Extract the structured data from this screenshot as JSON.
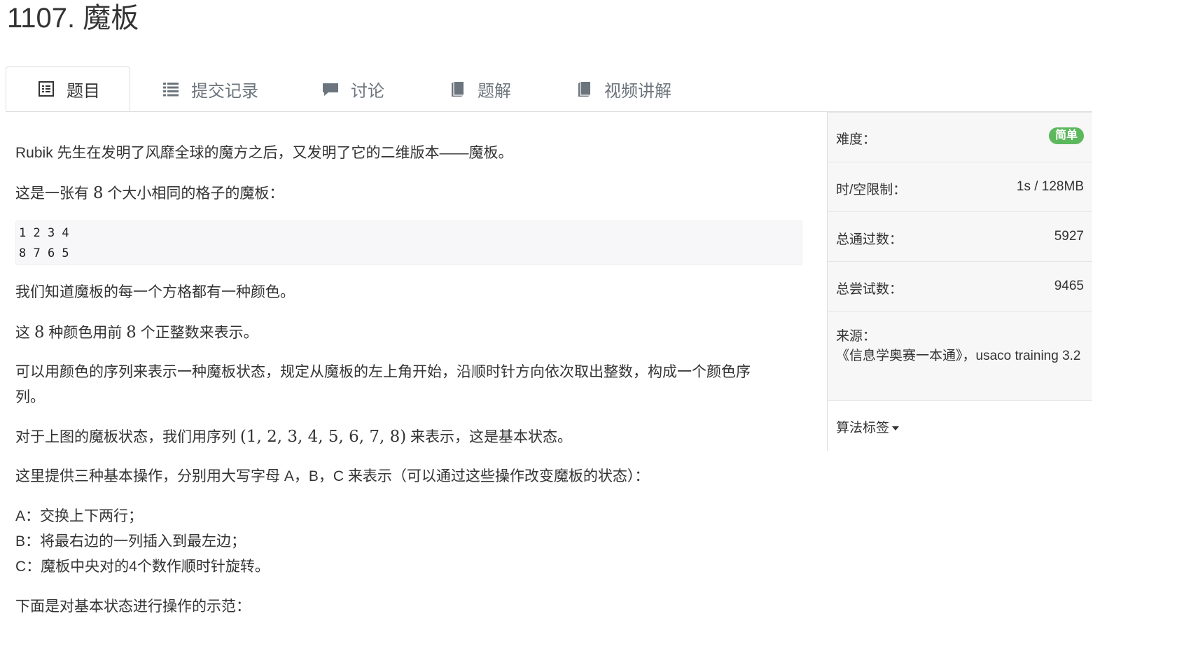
{
  "problem": {
    "number": "1107.",
    "name": "魔板"
  },
  "tabs": [
    {
      "label": "题目",
      "icon": "list-alt-icon",
      "active": true
    },
    {
      "label": "提交记录",
      "icon": "list-icon",
      "active": false
    },
    {
      "label": "讨论",
      "icon": "comment-icon",
      "active": false
    },
    {
      "label": "题解",
      "icon": "book-icon",
      "active": false
    },
    {
      "label": "视频讲解",
      "icon": "book-icon",
      "active": false
    }
  ],
  "content": {
    "p1": "Rubik 先生在发明了风靡全球的魔方之后，又发明了它的二维版本——魔板。",
    "p2_pre": "这是一张有 ",
    "p2_num": "8",
    "p2_post": " 个大小相同的格子的魔板：",
    "code": "1 2 3 4\n8 7 6 5",
    "p3": "我们知道魔板的每一个方格都有一种颜色。",
    "p4_pre": "这 ",
    "p4_num1": "8",
    "p4_mid": " 种颜色用前 ",
    "p4_num2": "8",
    "p4_post": " 个正整数来表示。",
    "p5_line1": "可以用颜色的序列来表示一种魔板状态，规定从魔板的左上角开始，沿顺时针方向依次取出整数，构成一个颜色序",
    "p5_line2": "列。",
    "p6_pre": "对于上图的魔板状态，我们用序列 ",
    "p6_math": "(1, 2, 3, 4, 5, 6, 7, 8)",
    "p6_post": " 来表示，这是基本状态。",
    "p7": "这里提供三种基本操作，分别用大写字母 A，B，C 来表示（可以通过这些操作改变魔板的状态）：",
    "op_a": "A：交换上下两行；",
    "op_b": "B：将最右边的一列插入到最左边；",
    "op_c": "C：魔板中央对的4个数作顺时针旋转。",
    "p8": "下面是对基本状态进行操作的示范："
  },
  "sidebar": {
    "difficulty_label": "难度：",
    "difficulty_value": "简单",
    "limit_label": "时/空限制：",
    "limit_value": "1s / 128MB",
    "accepted_label": "总通过数：",
    "accepted_value": "5927",
    "attempts_label": "总尝试数：",
    "attempts_value": "9465",
    "source_label": "来源：",
    "source_value": "《信息学奥赛一本通》，usaco training 3.2",
    "tags_label": "算法标签"
  },
  "colors": {
    "badge_green": "#5cb85c",
    "tab_inactive": "#6c757d",
    "sidebar_bg": "#f7f7f7"
  }
}
